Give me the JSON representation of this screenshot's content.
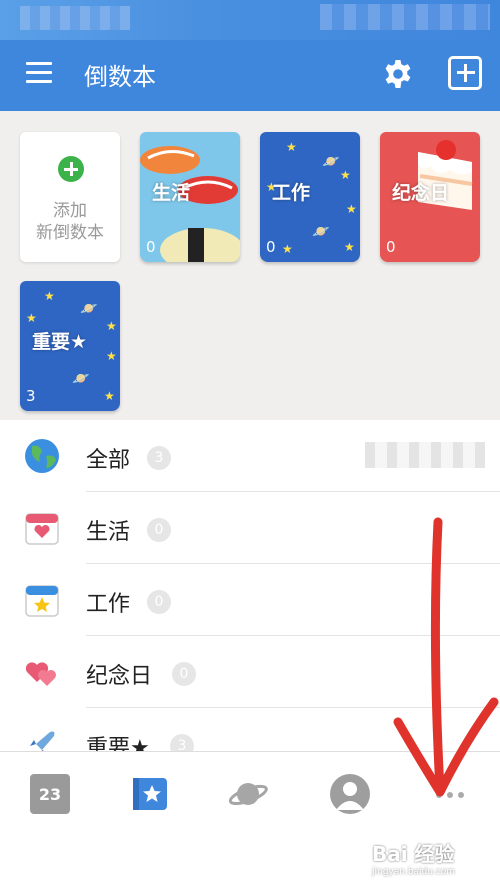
{
  "app": {
    "title": "倒数本"
  },
  "books": {
    "add_line1": "添加",
    "add_line2": "新倒数本",
    "items": [
      {
        "label": "生活",
        "count": "0"
      },
      {
        "label": "工作",
        "count": "0"
      },
      {
        "label": "纪念日",
        "count": "0"
      },
      {
        "label": "重要★",
        "count": "3"
      }
    ]
  },
  "list": [
    {
      "name": "全部",
      "count": "3",
      "icon": "globe-icon"
    },
    {
      "name": "生活",
      "count": "0",
      "icon": "calendar-heart-icon"
    },
    {
      "name": "工作",
      "count": "0",
      "icon": "calendar-star-icon"
    },
    {
      "name": "纪念日",
      "count": "0",
      "icon": "hearts-icon"
    },
    {
      "name": "重要★",
      "count": "3",
      "icon": "rocket-icon"
    }
  ],
  "bottom_nav": {
    "calendar_day": "23"
  },
  "watermark": {
    "brand": "Bai 经验",
    "url": "jingyan.baidu.com"
  },
  "colors": {
    "primary": "#3f86dd",
    "annotation_arrow": "#e0332c"
  }
}
